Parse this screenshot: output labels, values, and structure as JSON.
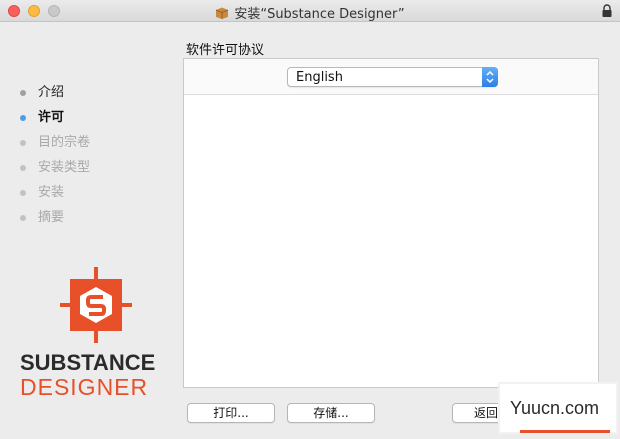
{
  "window": {
    "title": "安装“Substance Designer”",
    "icons": {
      "package": "package-icon",
      "lock": "lock-icon"
    }
  },
  "sidebar": {
    "steps": [
      {
        "label": "介绍",
        "state": "done"
      },
      {
        "label": "许可",
        "state": "active"
      },
      {
        "label": "目的宗卷",
        "state": "pending"
      },
      {
        "label": "安装类型",
        "state": "pending"
      },
      {
        "label": "安装",
        "state": "pending"
      },
      {
        "label": "摘要",
        "state": "pending"
      }
    ],
    "logo": {
      "line1": "SUBSTANCE",
      "line2": "DESIGNER",
      "brand_color": "#e8502a"
    }
  },
  "main": {
    "section_title": "软件许可协议",
    "language_select": {
      "value": "English"
    }
  },
  "buttons": {
    "print": "打印...",
    "save": "存储...",
    "back": "返回"
  },
  "watermark": {
    "text": "Yuucn.com"
  },
  "colors": {
    "accent": "#4d9ee8",
    "brand": "#e8502a"
  }
}
